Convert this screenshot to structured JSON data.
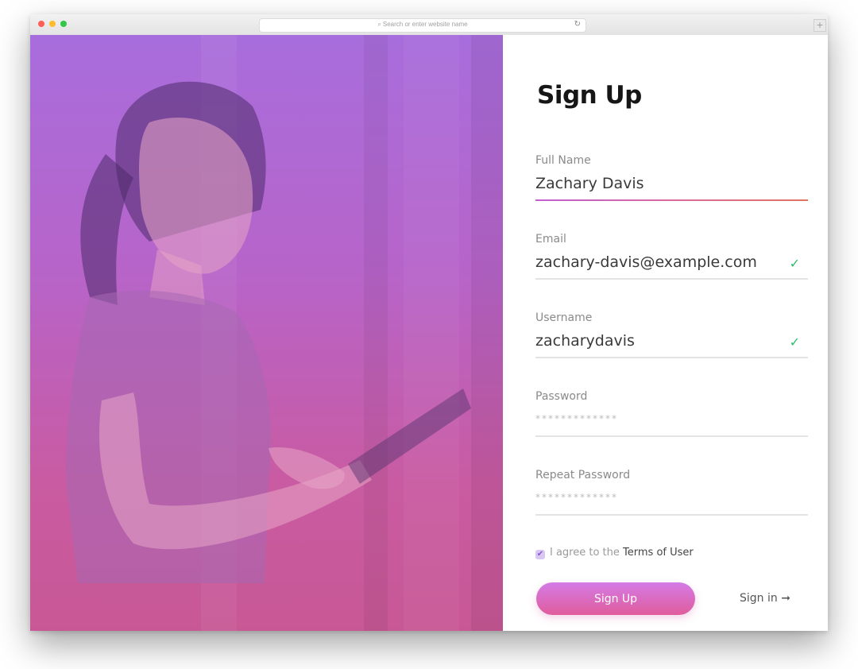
{
  "browser": {
    "address_placeholder": "Search or enter website name",
    "new_tab_label": "+"
  },
  "colors": {
    "gradient_top": "#a86ddc",
    "gradient_bottom": "#c85895",
    "button_start": "#d47be6",
    "button_end": "#e05c9c",
    "valid_check": "#2dbd6e"
  },
  "form": {
    "title": "Sign Up",
    "fields": [
      {
        "label": "Full Name",
        "value": "Zachary Davis",
        "valid": false,
        "active": true
      },
      {
        "label": "Email",
        "value": "zachary-davis@example.com",
        "valid": true
      },
      {
        "label": "Username",
        "value": "zacharydavis",
        "valid": true
      },
      {
        "label": "Password",
        "value": "*************"
      },
      {
        "label": "Repeat Password",
        "value": "*************"
      }
    ],
    "agree_prefix": "I agree to the",
    "agree_terms": "Terms of User",
    "agree_checked": true,
    "submit_label": "Sign Up",
    "signin_label": "Sign in",
    "signin_arrow": "➞",
    "check_glyph": "✓"
  },
  "hero": {
    "icon": "woman-with-tablet-photo"
  }
}
